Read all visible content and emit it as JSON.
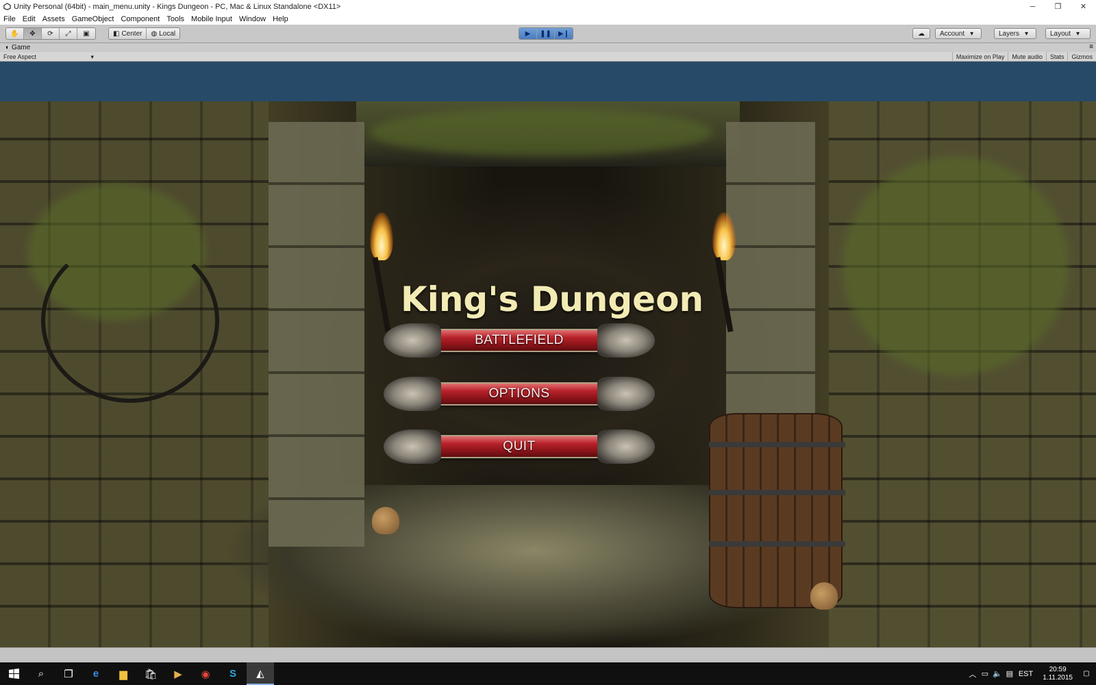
{
  "window": {
    "title": "Unity Personal (64bit) - main_menu.unity - Kings Dungeon - PC, Mac & Linux Standalone <DX11>",
    "controls": {
      "minimize": "─",
      "maximize": "❐",
      "close": "✕"
    }
  },
  "menu": [
    "File",
    "Edit",
    "Assets",
    "GameObject",
    "Component",
    "Tools",
    "Mobile Input",
    "Window",
    "Help"
  ],
  "toolbar": {
    "pivot_label": "Center",
    "space_label": "Local",
    "account_label": "Account",
    "layers_label": "Layers",
    "layout_label": "Layout",
    "play_icons": [
      "play-icon",
      "pause-icon",
      "step-icon"
    ],
    "tool_icons": [
      "hand-icon",
      "move-icon",
      "rotate-icon",
      "scale-icon",
      "rect-icon"
    ]
  },
  "game_view": {
    "tab_label": "Game",
    "aspect_label": "Free Aspect",
    "buttons": [
      "Maximize on Play",
      "Mute audio",
      "Stats",
      "Gizmos"
    ]
  },
  "game": {
    "title": "King's Dungeon",
    "menu_buttons": [
      "BATTLEFIELD",
      "OPTIONS",
      "QUIT"
    ]
  },
  "taskbar": {
    "language": "EST",
    "time": "20:59",
    "date": "1.11.2015"
  },
  "colors": {
    "viewport_bg": "#274a68",
    "title_text": "#f3ebb4",
    "button_red": "#b8222a",
    "play_active": "#4a7cc0"
  }
}
